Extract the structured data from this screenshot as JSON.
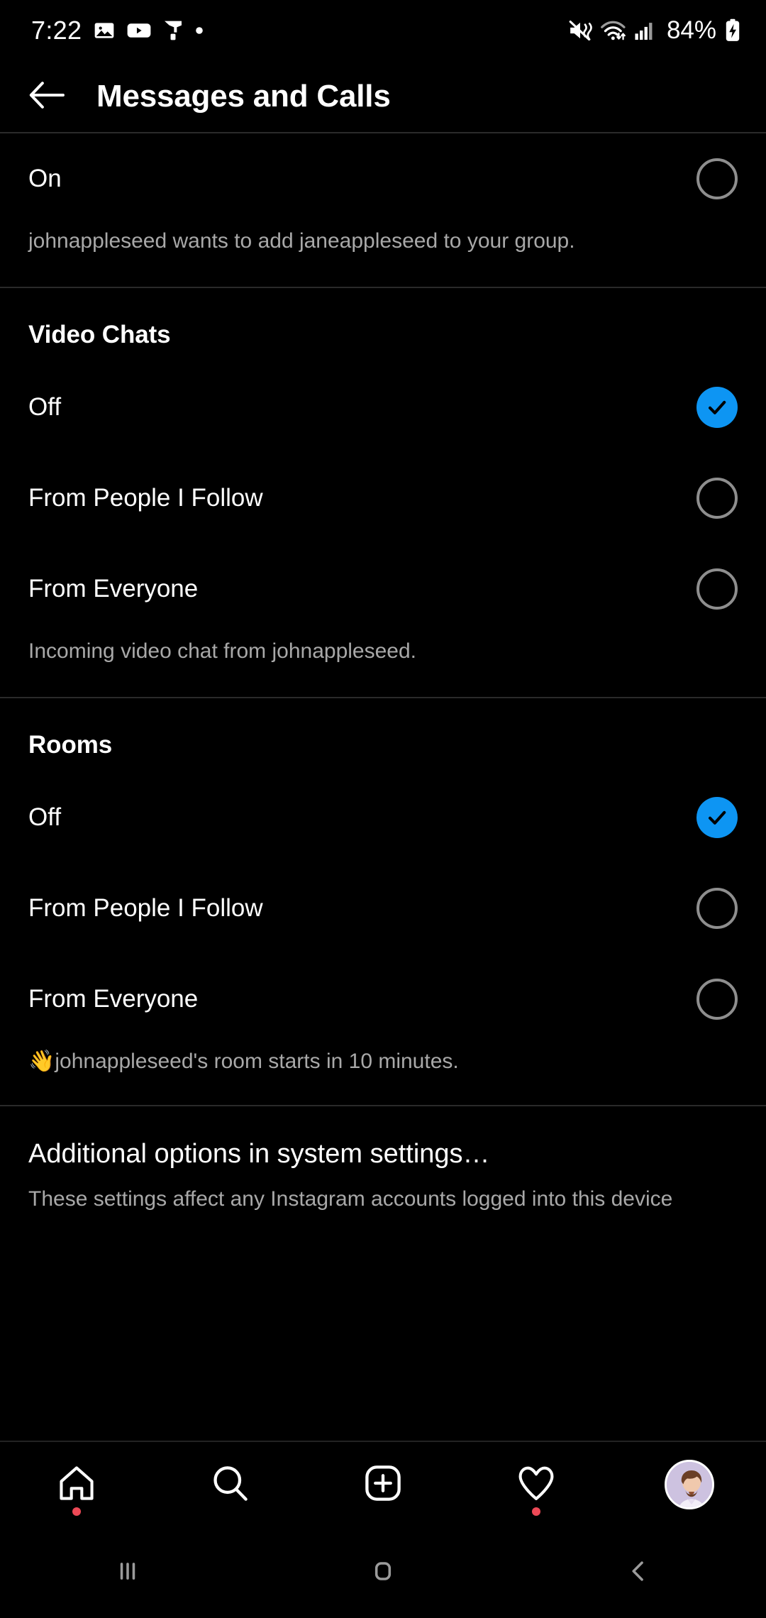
{
  "status_bar": {
    "time": "7:22",
    "battery": "84%",
    "icons_left": [
      "photos-icon",
      "youtube-icon",
      "tape-measure-icon",
      "dot-icon"
    ],
    "icons_right": [
      "mute-vibrate-icon",
      "wifi-icon",
      "cellular-signal-icon",
      "battery-charging-icon"
    ]
  },
  "header": {
    "back_icon": "back-arrow-icon",
    "title": "Messages and Calls"
  },
  "sections": [
    {
      "id": "group-requests",
      "title": "",
      "options": [
        {
          "label": "On",
          "selected": false
        }
      ],
      "hint": "johnappleseed wants to add janeappleseed to your group."
    },
    {
      "id": "video-chats",
      "title": "Video Chats",
      "options": [
        {
          "label": "Off",
          "selected": true
        },
        {
          "label": "From People I Follow",
          "selected": false
        },
        {
          "label": "From Everyone",
          "selected": false
        }
      ],
      "hint": "Incoming video chat from johnappleseed."
    },
    {
      "id": "rooms",
      "title": "Rooms",
      "options": [
        {
          "label": "Off",
          "selected": true
        },
        {
          "label": "From People I Follow",
          "selected": false
        },
        {
          "label": "From Everyone",
          "selected": false
        }
      ],
      "hint": "👋johnappleseed's room starts in 10 minutes."
    }
  ],
  "additional": {
    "title": "Additional options in system settings…",
    "subtitle": "These settings affect any Instagram accounts logged into this device"
  },
  "tabbar": {
    "items": [
      {
        "name": "home-icon",
        "badge": true
      },
      {
        "name": "search-icon",
        "badge": false
      },
      {
        "name": "add-post-icon",
        "badge": false
      },
      {
        "name": "activity-heart-icon",
        "badge": true
      },
      {
        "name": "profile-avatar",
        "badge": false
      }
    ]
  },
  "system_nav": {
    "recents": "recents-icon",
    "home": "home-square-icon",
    "back": "back-chevron-icon"
  },
  "colors": {
    "accent_blue": "#0d95f3",
    "badge_red": "#ed4956",
    "secondary_text": "#a8a8a8",
    "divider": "#2a2a2a",
    "background": "#000000"
  }
}
